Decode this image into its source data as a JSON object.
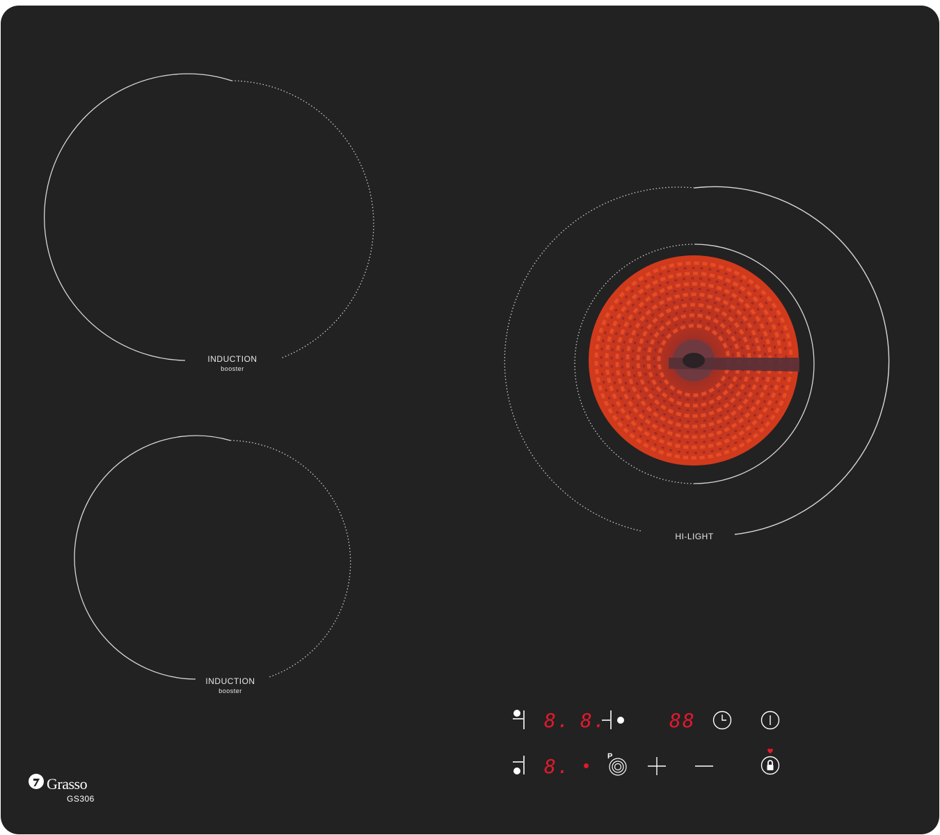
{
  "brand": {
    "name": "Grasso",
    "model": "GS306"
  },
  "zones": {
    "top_left": {
      "label": "INDUCTION",
      "sublabel": "booster"
    },
    "bottom_left": {
      "label": "INDUCTION",
      "sublabel": "booster"
    },
    "right": {
      "label": "HI-LIGHT"
    }
  },
  "controls": {
    "display_rear_left": "8.",
    "display_rear_right": "8.",
    "display_timer": "88",
    "display_front_left": "8."
  },
  "colors": {
    "surface": "#222222",
    "display_red": "#e0192d",
    "heating_element": "#c8341f"
  },
  "icons": {
    "zone_select_rear_left": "zone-rear-left-icon",
    "zone_select_rear_right": "zone-rear-right-icon",
    "zone_select_front_left": "zone-front-left-icon",
    "timer": "clock-icon",
    "power": "power-icon",
    "booster": "booster-p-icon",
    "increase": "plus-icon",
    "decrease": "minus-icon",
    "lock": "lock-icon"
  }
}
